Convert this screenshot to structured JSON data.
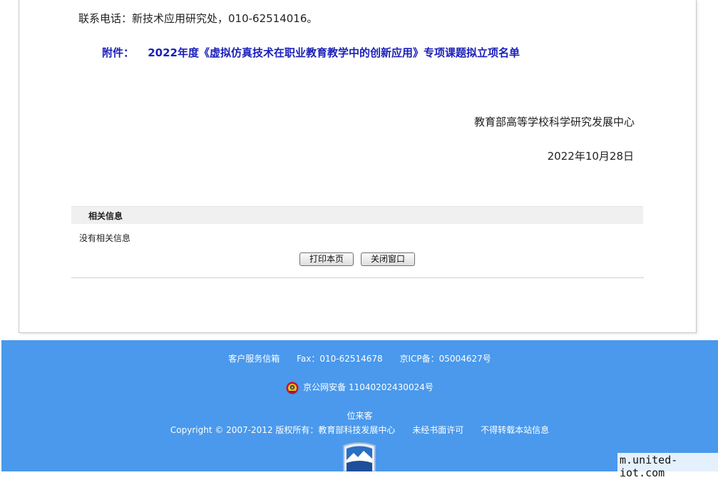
{
  "article": {
    "contact": "联系电话：新技术应用研究处，010-62514016。",
    "attachment_label": "附件：",
    "attachment_title": "2022年度《虚拟仿真技术在职业教育教学中的创新应用》专项课题拟立项名单",
    "organization": "教育部高等学校科学研究发展中心",
    "date": "2022年10月28日"
  },
  "related": {
    "title": "相关信息",
    "empty_text": "没有相关信息"
  },
  "buttons": {
    "print": "打印本页",
    "close": "关闭窗口"
  },
  "footer": {
    "mailbox": "客户服务信箱",
    "fax": "Fax：010-62514678",
    "icp": "京ICP备：05004627号",
    "police": "京公网安备 11040202430024号",
    "visitors": "位来客",
    "copyright": "Copyright © 2007-2012 版权所有：教育部科技发展中心",
    "no_permission": "未经书面许可",
    "no_reprint": "不得转载本站信息",
    "bg_color": "#4a99ec"
  },
  "watermark": "m.united-iot.com"
}
